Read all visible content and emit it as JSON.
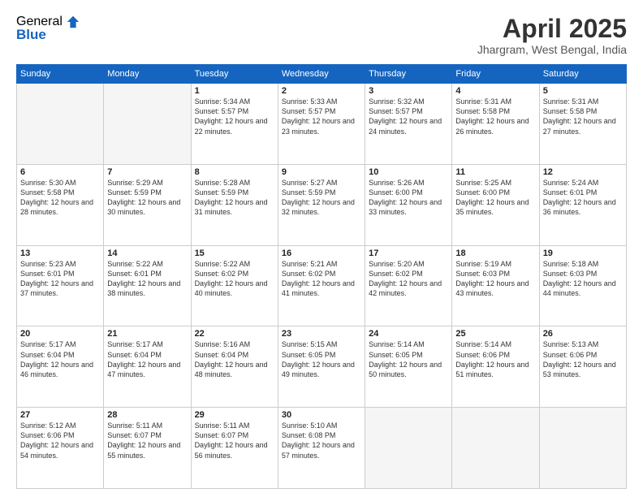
{
  "logo": {
    "general": "General",
    "blue": "Blue"
  },
  "title": "April 2025",
  "location": "Jhargram, West Bengal, India",
  "days_of_week": [
    "Sunday",
    "Monday",
    "Tuesday",
    "Wednesday",
    "Thursday",
    "Friday",
    "Saturday"
  ],
  "weeks": [
    [
      {
        "day": "",
        "empty": true
      },
      {
        "day": "",
        "empty": true
      },
      {
        "day": "1",
        "sunrise": "Sunrise: 5:34 AM",
        "sunset": "Sunset: 5:57 PM",
        "daylight": "Daylight: 12 hours and 22 minutes."
      },
      {
        "day": "2",
        "sunrise": "Sunrise: 5:33 AM",
        "sunset": "Sunset: 5:57 PM",
        "daylight": "Daylight: 12 hours and 23 minutes."
      },
      {
        "day": "3",
        "sunrise": "Sunrise: 5:32 AM",
        "sunset": "Sunset: 5:57 PM",
        "daylight": "Daylight: 12 hours and 24 minutes."
      },
      {
        "day": "4",
        "sunrise": "Sunrise: 5:31 AM",
        "sunset": "Sunset: 5:58 PM",
        "daylight": "Daylight: 12 hours and 26 minutes."
      },
      {
        "day": "5",
        "sunrise": "Sunrise: 5:31 AM",
        "sunset": "Sunset: 5:58 PM",
        "daylight": "Daylight: 12 hours and 27 minutes."
      }
    ],
    [
      {
        "day": "6",
        "sunrise": "Sunrise: 5:30 AM",
        "sunset": "Sunset: 5:58 PM",
        "daylight": "Daylight: 12 hours and 28 minutes."
      },
      {
        "day": "7",
        "sunrise": "Sunrise: 5:29 AM",
        "sunset": "Sunset: 5:59 PM",
        "daylight": "Daylight: 12 hours and 30 minutes."
      },
      {
        "day": "8",
        "sunrise": "Sunrise: 5:28 AM",
        "sunset": "Sunset: 5:59 PM",
        "daylight": "Daylight: 12 hours and 31 minutes."
      },
      {
        "day": "9",
        "sunrise": "Sunrise: 5:27 AM",
        "sunset": "Sunset: 5:59 PM",
        "daylight": "Daylight: 12 hours and 32 minutes."
      },
      {
        "day": "10",
        "sunrise": "Sunrise: 5:26 AM",
        "sunset": "Sunset: 6:00 PM",
        "daylight": "Daylight: 12 hours and 33 minutes."
      },
      {
        "day": "11",
        "sunrise": "Sunrise: 5:25 AM",
        "sunset": "Sunset: 6:00 PM",
        "daylight": "Daylight: 12 hours and 35 minutes."
      },
      {
        "day": "12",
        "sunrise": "Sunrise: 5:24 AM",
        "sunset": "Sunset: 6:01 PM",
        "daylight": "Daylight: 12 hours and 36 minutes."
      }
    ],
    [
      {
        "day": "13",
        "sunrise": "Sunrise: 5:23 AM",
        "sunset": "Sunset: 6:01 PM",
        "daylight": "Daylight: 12 hours and 37 minutes."
      },
      {
        "day": "14",
        "sunrise": "Sunrise: 5:22 AM",
        "sunset": "Sunset: 6:01 PM",
        "daylight": "Daylight: 12 hours and 38 minutes."
      },
      {
        "day": "15",
        "sunrise": "Sunrise: 5:22 AM",
        "sunset": "Sunset: 6:02 PM",
        "daylight": "Daylight: 12 hours and 40 minutes."
      },
      {
        "day": "16",
        "sunrise": "Sunrise: 5:21 AM",
        "sunset": "Sunset: 6:02 PM",
        "daylight": "Daylight: 12 hours and 41 minutes."
      },
      {
        "day": "17",
        "sunrise": "Sunrise: 5:20 AM",
        "sunset": "Sunset: 6:02 PM",
        "daylight": "Daylight: 12 hours and 42 minutes."
      },
      {
        "day": "18",
        "sunrise": "Sunrise: 5:19 AM",
        "sunset": "Sunset: 6:03 PM",
        "daylight": "Daylight: 12 hours and 43 minutes."
      },
      {
        "day": "19",
        "sunrise": "Sunrise: 5:18 AM",
        "sunset": "Sunset: 6:03 PM",
        "daylight": "Daylight: 12 hours and 44 minutes."
      }
    ],
    [
      {
        "day": "20",
        "sunrise": "Sunrise: 5:17 AM",
        "sunset": "Sunset: 6:04 PM",
        "daylight": "Daylight: 12 hours and 46 minutes."
      },
      {
        "day": "21",
        "sunrise": "Sunrise: 5:17 AM",
        "sunset": "Sunset: 6:04 PM",
        "daylight": "Daylight: 12 hours and 47 minutes."
      },
      {
        "day": "22",
        "sunrise": "Sunrise: 5:16 AM",
        "sunset": "Sunset: 6:04 PM",
        "daylight": "Daylight: 12 hours and 48 minutes."
      },
      {
        "day": "23",
        "sunrise": "Sunrise: 5:15 AM",
        "sunset": "Sunset: 6:05 PM",
        "daylight": "Daylight: 12 hours and 49 minutes."
      },
      {
        "day": "24",
        "sunrise": "Sunrise: 5:14 AM",
        "sunset": "Sunset: 6:05 PM",
        "daylight": "Daylight: 12 hours and 50 minutes."
      },
      {
        "day": "25",
        "sunrise": "Sunrise: 5:14 AM",
        "sunset": "Sunset: 6:06 PM",
        "daylight": "Daylight: 12 hours and 51 minutes."
      },
      {
        "day": "26",
        "sunrise": "Sunrise: 5:13 AM",
        "sunset": "Sunset: 6:06 PM",
        "daylight": "Daylight: 12 hours and 53 minutes."
      }
    ],
    [
      {
        "day": "27",
        "sunrise": "Sunrise: 5:12 AM",
        "sunset": "Sunset: 6:06 PM",
        "daylight": "Daylight: 12 hours and 54 minutes."
      },
      {
        "day": "28",
        "sunrise": "Sunrise: 5:11 AM",
        "sunset": "Sunset: 6:07 PM",
        "daylight": "Daylight: 12 hours and 55 minutes."
      },
      {
        "day": "29",
        "sunrise": "Sunrise: 5:11 AM",
        "sunset": "Sunset: 6:07 PM",
        "daylight": "Daylight: 12 hours and 56 minutes."
      },
      {
        "day": "30",
        "sunrise": "Sunrise: 5:10 AM",
        "sunset": "Sunset: 6:08 PM",
        "daylight": "Daylight: 12 hours and 57 minutes."
      },
      {
        "day": "",
        "empty": true
      },
      {
        "day": "",
        "empty": true
      },
      {
        "day": "",
        "empty": true
      }
    ]
  ]
}
